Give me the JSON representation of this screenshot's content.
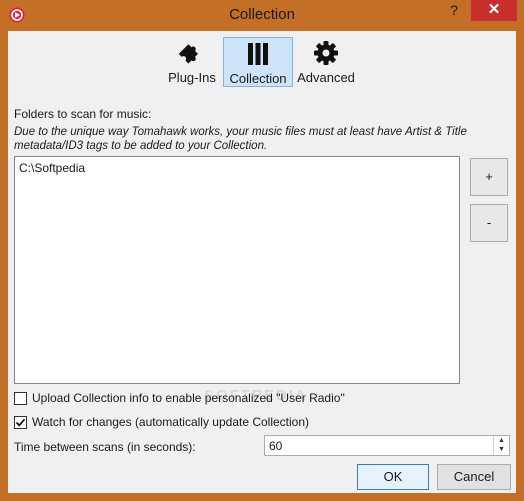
{
  "window": {
    "title": "Collection",
    "help_label": "?",
    "close_label": "✕"
  },
  "toolbar": {
    "tabs": [
      {
        "label": "Plug-Ins",
        "icon": "puzzle-icon",
        "selected": false
      },
      {
        "label": "Collection",
        "icon": "collection-icon",
        "selected": true
      },
      {
        "label": "Advanced",
        "icon": "gear-icon",
        "selected": false
      }
    ]
  },
  "folders": {
    "heading": "Folders to scan for music:",
    "note": "Due to the unique way Tomahawk works, your music files must at least have Artist & Title metadata/ID3 tags to be added to your Collection.",
    "items": [
      "C:\\Softpedia"
    ],
    "add_label": "+",
    "remove_label": "-"
  },
  "options": {
    "upload": {
      "label": "Upload Collection info to enable personalized \"User Radio\"",
      "checked": false
    },
    "watch": {
      "label": "Watch for changes (automatically update Collection)",
      "checked": true
    }
  },
  "scan": {
    "label": "Time between scans (in seconds):",
    "value": "60"
  },
  "buttons": {
    "ok": "OK",
    "cancel": "Cancel"
  },
  "watermark": "SOFTPEDIA",
  "colors": {
    "frame": "#c46f27",
    "close": "#c7302c",
    "selected_tab": "#cde3f7"
  }
}
